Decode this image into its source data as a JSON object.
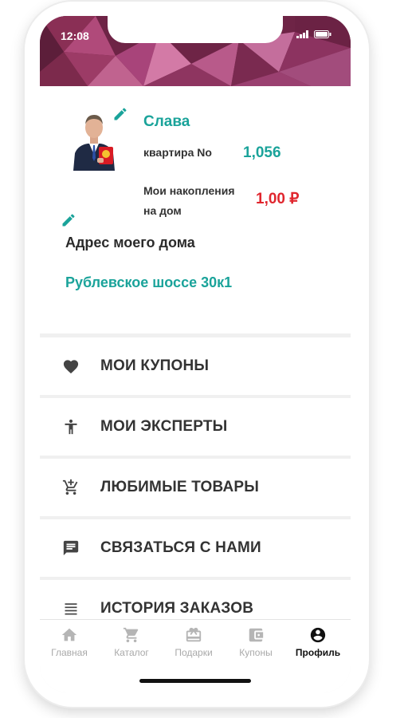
{
  "status_bar": {
    "time": "12:08"
  },
  "profile": {
    "name": "Слава",
    "apartment_label": "квартира No",
    "apartment_value": "1,056",
    "savings_label_line1": "Мои накопления",
    "savings_label_line2": "на дом",
    "savings_value": "1,00 ₽",
    "address_label": "Адрес моего дома",
    "address_value": "Рублевское шоссе 30к1"
  },
  "menu": [
    {
      "label": "МОИ КУПОНЫ",
      "icon": "heart-icon"
    },
    {
      "label": "МОИ ЭКСПЕРТЫ",
      "icon": "person-icon"
    },
    {
      "label": "ЛЮБИМЫЕ ТОВАРЫ",
      "icon": "cart-add-icon"
    },
    {
      "label": "СВЯЗАТЬСЯ С НАМИ",
      "icon": "chat-icon"
    },
    {
      "label": "ИСТОРИЯ ЗАКАЗОВ",
      "icon": "list-icon"
    }
  ],
  "tabs": [
    {
      "label": "Главная",
      "icon": "home-icon"
    },
    {
      "label": "Каталог",
      "icon": "cart-icon"
    },
    {
      "label": "Подарки",
      "icon": "gift-icon"
    },
    {
      "label": "Купоны",
      "icon": "wallet-icon"
    },
    {
      "label": "Профиль",
      "icon": "account-icon",
      "active": true
    }
  ],
  "colors": {
    "accent": "#1aa39a",
    "price": "#e0262e",
    "header": "#7a2a4a"
  }
}
